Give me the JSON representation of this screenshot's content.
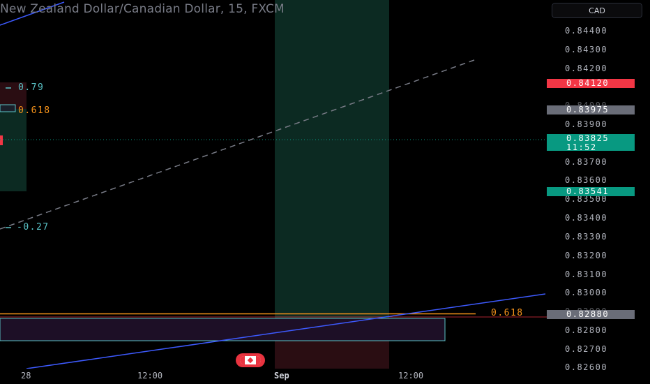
{
  "header": {
    "title": "New Zealand Dollar/Canadian Dollar, 15, FXCM",
    "currency_button": "CAD"
  },
  "price_axis": {
    "ticks": [
      "0.84400",
      "0.84300",
      "0.84200",
      "0.84000",
      "0.83900",
      "0.83700",
      "0.83600",
      "0.83500",
      "0.83400",
      "0.83300",
      "0.83200",
      "0.83100",
      "0.83000",
      "0.82900",
      "0.82800",
      "0.82700",
      "0.82600"
    ]
  },
  "price_tags": {
    "red_level": "0.84120",
    "grey_level": "0.83975",
    "current_price": "0.83825",
    "countdown": "11:52",
    "green_level": "0.83541",
    "lower_grey_level": "0.82880"
  },
  "fib_labels": {
    "upper": "0.79",
    "middle": "0.618",
    "lower": "-0.27",
    "bottom": "0.618"
  },
  "time_axis": {
    "ticks": [
      "28",
      "12:00",
      "Sep",
      "12:00"
    ]
  },
  "colors": {
    "background": "#000000",
    "trendline": "#3d5afe",
    "fib_orange": "#f7931a",
    "fib_teal": "#5ac4c8",
    "tag_red": "#f23645",
    "tag_green": "#089981",
    "tag_grey": "#6a6d78",
    "session_green": "#0c2a22",
    "session_red": "#2a0d12"
  },
  "icons": {
    "event_flag": "canada-flag-icon"
  }
}
